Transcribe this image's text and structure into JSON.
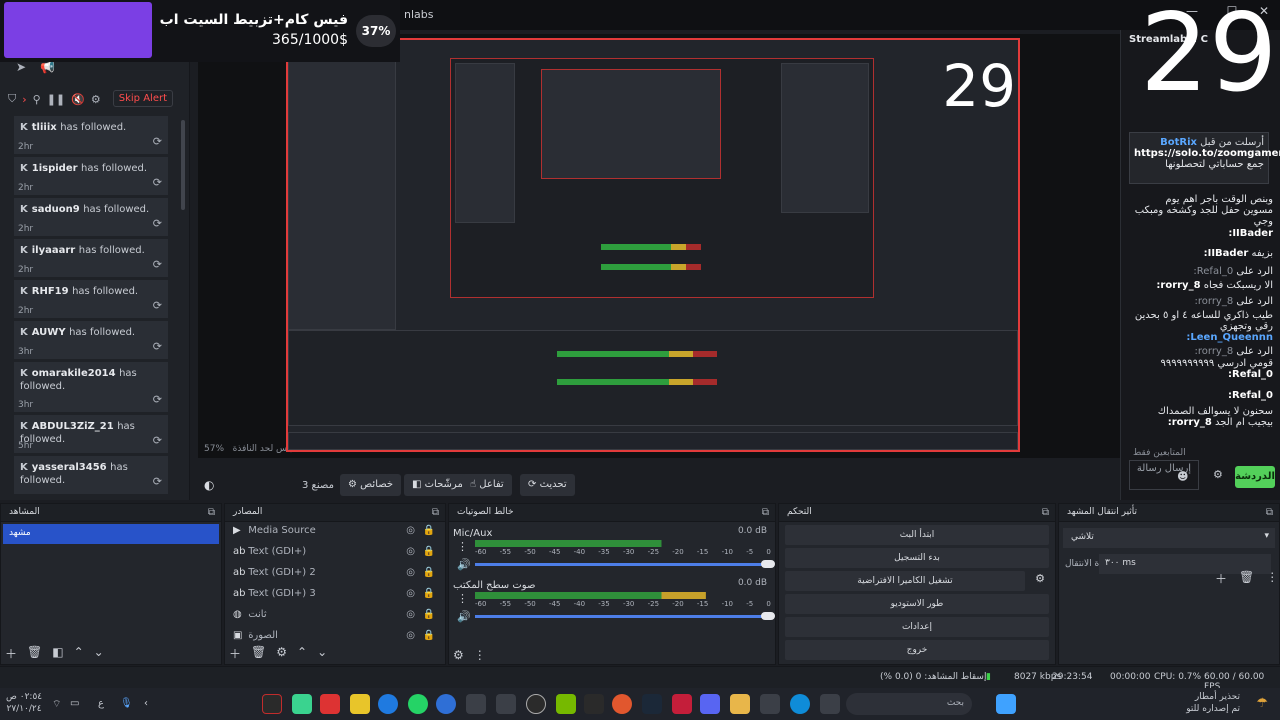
{
  "app": {
    "title_fragment": "nlabs"
  },
  "goal": {
    "title": "فيس كام+تزبيط السيت اب",
    "amount": "365/1000$",
    "percent_label": "37%",
    "progress": 0.37
  },
  "overlay": {
    "counter": "29"
  },
  "alerts": {
    "skip_label": "Skip Alert",
    "items": [
      {
        "user": "tliiix",
        "action": "has followed.",
        "time": "2hr"
      },
      {
        "user": "1ispider",
        "action": "has followed.",
        "time": "2hr"
      },
      {
        "user": "saduon9",
        "action": "has followed.",
        "time": "2hr"
      },
      {
        "user": "ilyaaarr",
        "action": "has followed.",
        "time": "2hr"
      },
      {
        "user": "RHF19",
        "action": "has followed.",
        "time": "2hr"
      },
      {
        "user": "AUWY",
        "action": "has followed.",
        "time": "3hr"
      },
      {
        "user": "omarakile2014",
        "action": "has followed.",
        "time": "3hr"
      },
      {
        "user": "ABDUL3ZiZ_21",
        "action": "has followed.",
        "time": "5hr"
      },
      {
        "user": "yasseral3456",
        "action": "has followed.",
        "time": ""
      }
    ]
  },
  "chat": {
    "header": "Streamlabs: C",
    "pinned": {
      "by": "BotRix",
      "label": "أرسلت من قبل",
      "link": "https://solo.to/zoomgamer1",
      "suffix": "جمع حساباتي لتحصلونها"
    },
    "messages": [
      {
        "user": "",
        "text": "وبنص الوقت باجر اهم يوم مسوين حفل للجد وكشخه ومبكب وجي"
      },
      {
        "user": "IIBader:",
        "text": ""
      },
      {
        "user": "IIBader:",
        "text": "بزيفه"
      },
      {
        "user": "Refal_0:",
        "text": "الرد على",
        "muted": true
      },
      {
        "user": "rorry_8:",
        "text": "الا ريسبكت فجاه"
      },
      {
        "user": "rorry_8:",
        "text": "الرد على",
        "muted": true
      },
      {
        "user": "Leen_Queennn:",
        "text": "طيب ذاكري للساعه ٤ او ٥ بحدين رقي وتجهزي"
      },
      {
        "user": "rorry_8:",
        "text": "الرد على",
        "muted": true
      },
      {
        "user": "Refal_0:",
        "text": "قومي ادرسي ٩٩٩٩٩٩٩٩٩٩"
      },
      {
        "user": "Refal_0:",
        "text": ""
      },
      {
        "user": "rorry_8:",
        "text": "سحنون لا يسوالف الصمداك بيجيب ام الجد"
      }
    ],
    "followers_only": "المتابعين فقط",
    "send_placeholder": "إرسال رسالة",
    "chat_button": "الدردشة"
  },
  "preview": {
    "zoom": "57%",
    "zoom_caption": "القياس لحد النافذة"
  },
  "controls": {
    "scene_count_label": "مصنع 3",
    "properties": "خصائص",
    "filters": "المرشّحات",
    "interact": "تفاعل",
    "refresh": "تحديث"
  },
  "docks": {
    "scenes": {
      "title": "المشاهد",
      "items": [
        "مشهد"
      ]
    },
    "sources": {
      "title": "المصادر",
      "items": [
        {
          "name": "Media Source",
          "icon": "play-icon"
        },
        {
          "name": "Text (GDI+)",
          "icon": "text-icon"
        },
        {
          "name": "Text (GDI+) 2",
          "icon": "text-icon"
        },
        {
          "name": "Text (GDI+) 3",
          "icon": "text-icon"
        },
        {
          "name": "ثانت",
          "icon": "globe-icon"
        },
        {
          "name": "الصورة",
          "icon": "image-icon"
        }
      ]
    },
    "mixer": {
      "title": "خالط الصوتيات",
      "channels": [
        {
          "name": "Mic/Aux",
          "db": "0.0 dB",
          "level": 0.63
        },
        {
          "name": "صوت سطح المكتب",
          "db": "0.0 dB",
          "level": 0.78
        }
      ],
      "scale": [
        "-60",
        "-55",
        "-50",
        "-45",
        "-40",
        "-35",
        "-30",
        "-25",
        "-20",
        "-15",
        "-10",
        "-5",
        "0"
      ]
    },
    "controls": {
      "title": "التحكم",
      "buttons": [
        "ابتدأ البث",
        "بدء التسجيل",
        "تشغيل الكاميرا الافتراضية",
        "طور الاستوديو",
        "إعدادات",
        "خروج"
      ]
    },
    "transitions": {
      "title": "تأثير انتقال المشهد",
      "type": "تلاشي",
      "duration_label": "مدة الانتقال",
      "duration": "٣٠٠ ms"
    }
  },
  "status": {
    "dropped": "إسقاط المشاهد: 0 (0.0 %)",
    "bitrate": "8027 kbps",
    "live_time": "29:23:54",
    "rec_time": "00:00:00",
    "cpu": "CPU: 0.7%",
    "fps": "60.00 / 60.00 FPS"
  },
  "taskbar": {
    "search": "بحث",
    "time": "٠٢:٥٤ ص",
    "date": "٢٧/١٠/٢٤",
    "lang": "ع",
    "weather_title": "تحذير أمطار",
    "weather_sub": "تم إصداره للتو"
  },
  "colors": {
    "accent_purple": "#7b3fe4",
    "selection_blue": "#2853c9",
    "alert_red": "#ff4d4d",
    "chat_green": "#53d05a",
    "preview_border": "#e23b3b"
  }
}
